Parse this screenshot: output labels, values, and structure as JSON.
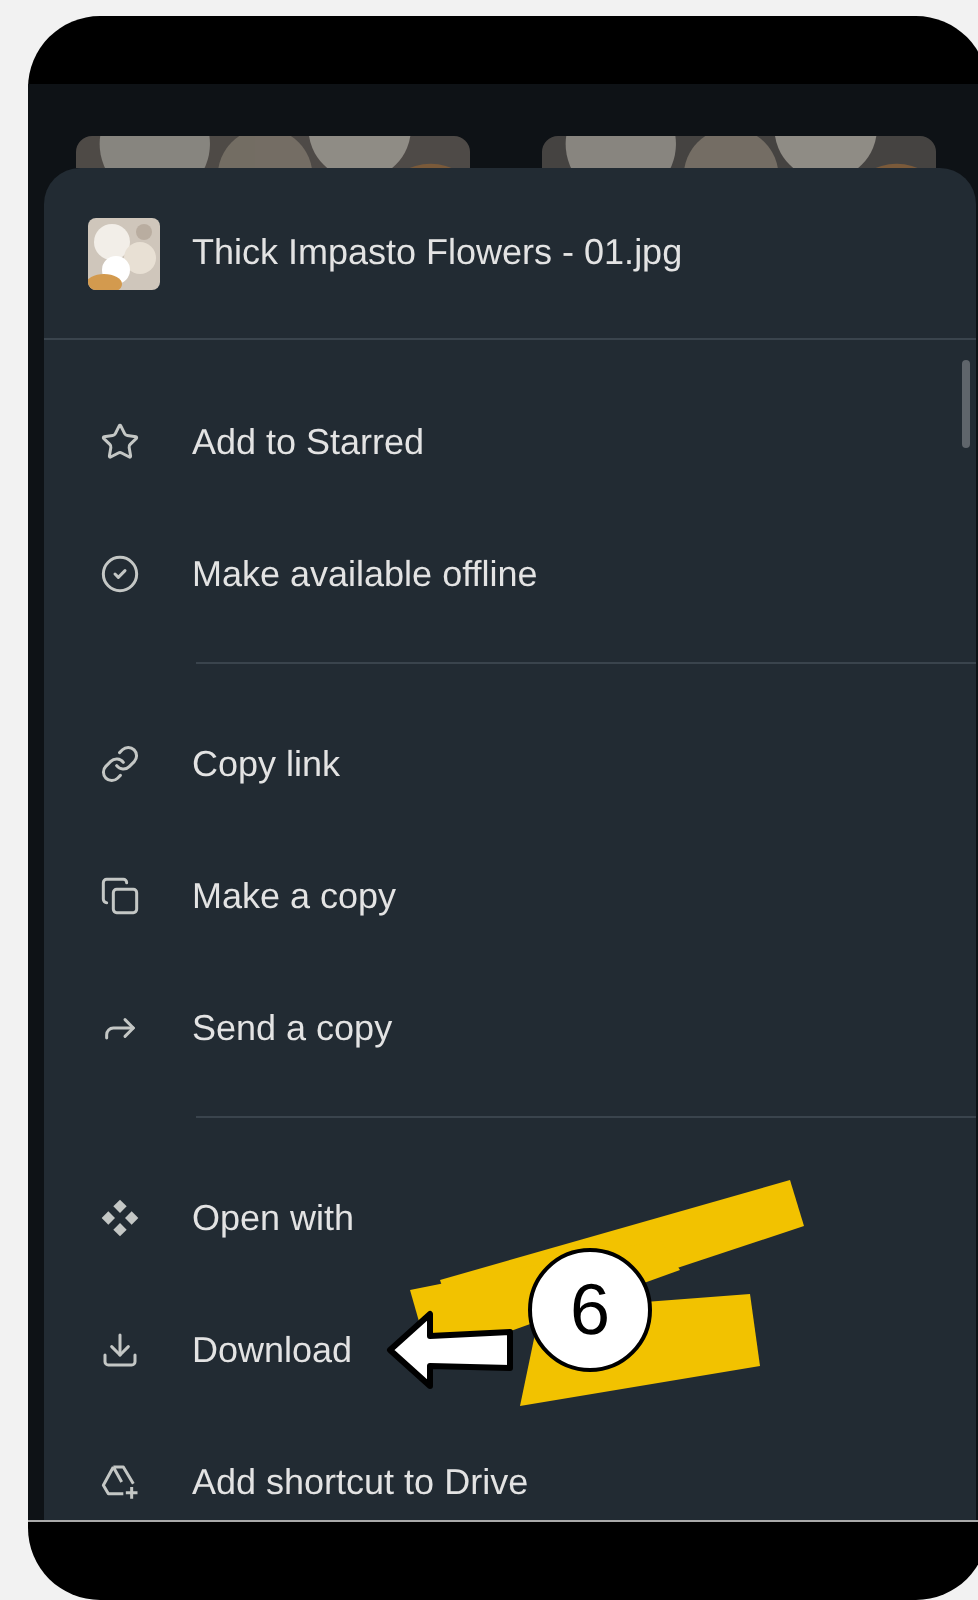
{
  "sheet": {
    "header": {
      "title": "Thick Impasto Flowers - 01.jpg"
    },
    "sections": [
      {
        "items": [
          {
            "kind": "star",
            "label": "Add to Starred"
          },
          {
            "kind": "offline",
            "label": "Make available offline"
          }
        ]
      },
      {
        "items": [
          {
            "kind": "link",
            "label": "Copy link"
          },
          {
            "kind": "copy",
            "label": "Make a copy"
          },
          {
            "kind": "send",
            "label": "Send a copy"
          }
        ]
      },
      {
        "items": [
          {
            "kind": "open",
            "label": "Open with"
          },
          {
            "kind": "download",
            "label": "Download"
          },
          {
            "kind": "shortcut",
            "label": "Add shortcut to Drive"
          }
        ]
      }
    ]
  },
  "annotation": {
    "step": "6"
  }
}
